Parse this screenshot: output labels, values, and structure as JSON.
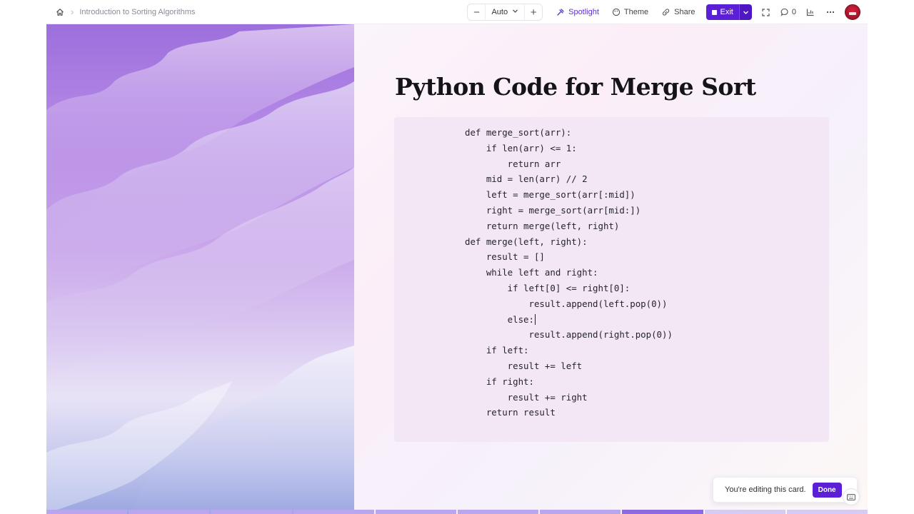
{
  "breadcrumb": {
    "title": "Introduction to Sorting Algorithms"
  },
  "toolbar": {
    "zoom_minus": "−",
    "zoom_value": "Auto",
    "zoom_plus": "+",
    "spotlight_label": "Spotlight",
    "theme_label": "Theme",
    "share_label": "Share",
    "exit_label": "Exit",
    "comment_count": "0"
  },
  "slide": {
    "title": "Python Code for Merge Sort",
    "code_lines": [
      "def merge_sort(arr):",
      "    if len(arr) <= 1:",
      "        return arr",
      "    mid = len(arr) // 2",
      "    left = merge_sort(arr[:mid])",
      "    right = merge_sort(arr[mid:])",
      "    return merge(left, right)",
      "def merge(left, right):",
      "    result = []",
      "    while left and right:",
      "        if left[0] <= right[0]:",
      "            result.append(left.pop(0))",
      "        else:",
      "            result.append(right.pop(0))",
      "    if left:",
      "        result += left",
      "    if right:",
      "        result += right",
      "    return result"
    ]
  },
  "toast": {
    "text": "You're editing this card.",
    "done_label": "Done"
  },
  "progress": {
    "segments": 10,
    "current_index": 7
  },
  "icons": [
    "home-icon",
    "chevron-right-icon",
    "chevron-down-icon",
    "spotlight-icon",
    "palette-icon",
    "link-icon",
    "stop-icon",
    "fullscreen-icon",
    "comment-icon",
    "analytics-icon",
    "more-icon",
    "keyboard-icon"
  ],
  "colors": {
    "accent": "#5b1fd6",
    "code_bg": "#f3e6f5"
  }
}
